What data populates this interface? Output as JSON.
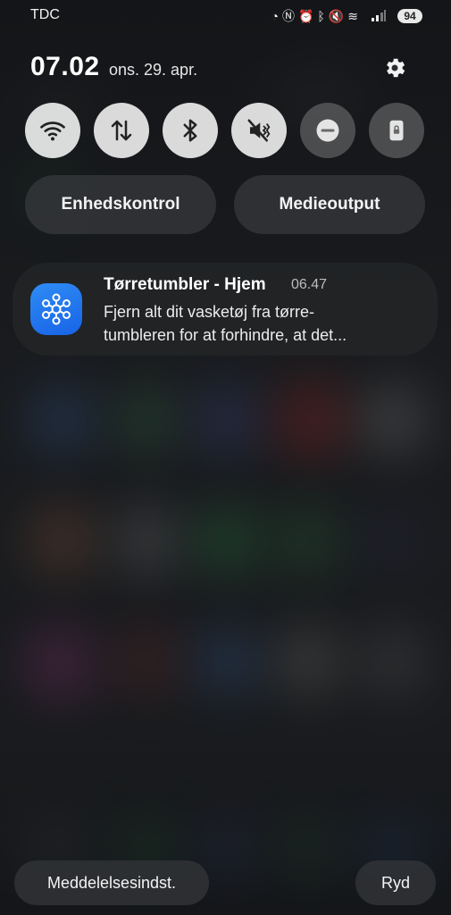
{
  "status_bar": {
    "carrier": "TDC",
    "icons": [
      "data-saver-icon",
      "nfc-icon",
      "alarm-icon",
      "bluetooth-icon",
      "mute-icon",
      "wifi-icon",
      "signal-icon"
    ],
    "battery": "94"
  },
  "header": {
    "time": "07.02",
    "date": "ons. 29. apr.",
    "settings_icon": "gear-icon"
  },
  "quick_settings": [
    {
      "icon": "wifi-icon",
      "state": "on"
    },
    {
      "icon": "mobile-data-icon",
      "state": "on"
    },
    {
      "icon": "bluetooth-icon",
      "state": "on"
    },
    {
      "icon": "mute-icon",
      "state": "on"
    },
    {
      "icon": "do-not-disturb-icon",
      "state": "off"
    },
    {
      "icon": "lock-screen-icon",
      "state": "off"
    }
  ],
  "controls": {
    "device_control": "Enhedskontrol",
    "media_output": "Medieoutput"
  },
  "notification": {
    "app_icon": "smartthings-icon",
    "title": "Tørretumbler - Hjem",
    "time": "06.47",
    "line1": "Fjern alt dit vasketøj fra tørre-",
    "line2": "tumbleren for at forhindre, at det..."
  },
  "footer": {
    "settings_button": "Meddelelsesindst.",
    "clear_button": "Ryd"
  },
  "colors": {
    "tile_on": "#ebebeb",
    "tile_off": "#787878",
    "app_icon": "#1e6ff0"
  }
}
